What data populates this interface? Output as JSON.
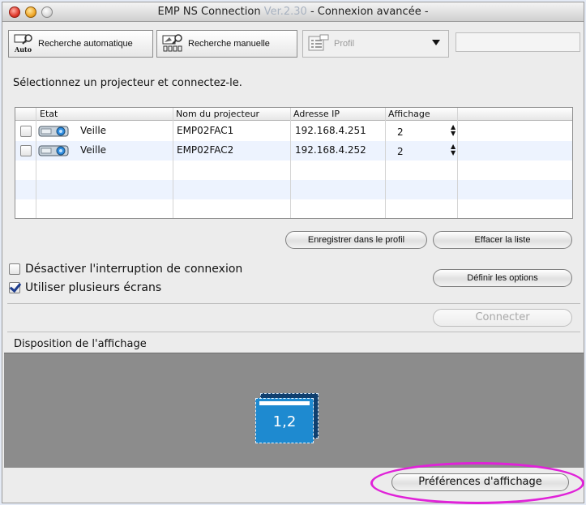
{
  "window": {
    "title_prefix": "EMP NS Connection ",
    "title_version": "Ver.2.30",
    "title_suffix": "  - Connexion avancée -"
  },
  "toolbar": {
    "auto_search_label": "Recherche automatique",
    "auto_icon_text": "Auto",
    "manual_search_label": "Recherche manuelle",
    "profile_label": "Profil"
  },
  "instruction": "Sélectionnez un projecteur et connectez-le.",
  "table": {
    "headers": [
      "Etat",
      "Nom du projecteur",
      "Adresse IP",
      "Affichage"
    ],
    "rows": [
      {
        "status": "Veille",
        "name": "EMP02FAC1",
        "ip": "192.168.4.251",
        "display": "2"
      },
      {
        "status": "Veille",
        "name": "EMP02FAC2",
        "ip": "192.168.4.252",
        "display": "2"
      }
    ]
  },
  "buttons": {
    "save_profile": "Enregistrer dans le profil",
    "clear_list": "Effacer la liste",
    "set_options": "Définir les options",
    "connect": "Connecter",
    "display_prefs": "Préférences d'affichage"
  },
  "options": {
    "disable_interrupt": {
      "label": "Désactiver l'interruption de connexion",
      "checked": false
    },
    "multi_screens": {
      "label": "Utiliser plusieurs écrans",
      "checked": true
    }
  },
  "layout_section": {
    "title": "Disposition de l'affichage",
    "screen_label": "1,2"
  },
  "colors": {
    "screen_fill": "#1e8ad0",
    "highlight": "#e022d8",
    "row_alt": "#edf3fe"
  }
}
